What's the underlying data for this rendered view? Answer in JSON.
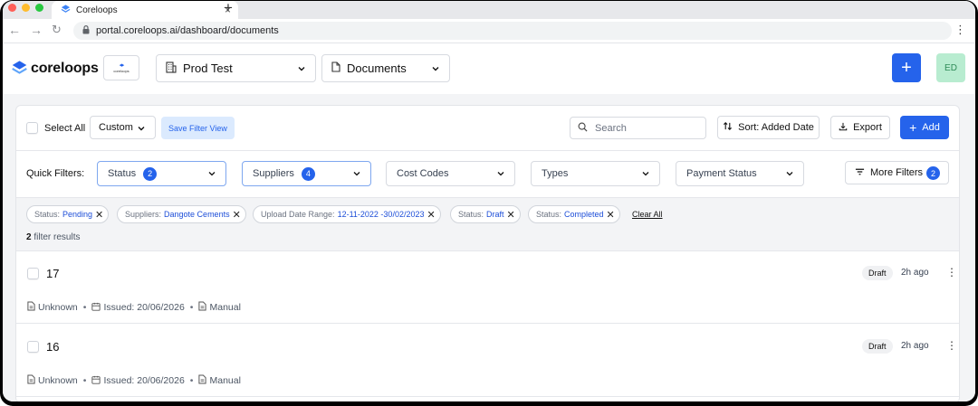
{
  "browser": {
    "tab_title": "Coreloops",
    "url": "portal.coreloops.ai/dashboard/documents",
    "tab_close": "×",
    "new_tab": "+",
    "menu_glyph": "⋮"
  },
  "header": {
    "logo_text": "coreloops",
    "org_thumb_text": "coreloops",
    "org_dropdown": "Prod Test",
    "section_dropdown": "Documents",
    "plus_glyph": "+",
    "avatar_initials": "ED"
  },
  "toolbar": {
    "select_all": "Select All",
    "view_dropdown": "Custom",
    "save_filter_view": "Save Filter View",
    "search_placeholder": "Search",
    "sort_label": "Sort: Added Date",
    "export_label": "Export",
    "add_label": "Add"
  },
  "quick_filters": {
    "label": "Quick Filters:",
    "items": [
      {
        "label": "Status",
        "count": "2"
      },
      {
        "label": "Suppliers",
        "count": "4"
      },
      {
        "label": "Cost Codes"
      },
      {
        "label": "Types"
      },
      {
        "label": "Payment Status"
      }
    ],
    "more_filters": {
      "label": "More Filters",
      "count": "2"
    }
  },
  "applied_filters": {
    "chips": [
      {
        "key": "Status:",
        "value": "Pending"
      },
      {
        "key": "Suppliers:",
        "value": "Dangote Cements"
      },
      {
        "key": "Upload Date Range:",
        "value": "12-11-2022 -30/02/2023"
      },
      {
        "key": "Status:",
        "value": "Draft"
      },
      {
        "key": "Status:",
        "value": "Completed"
      }
    ],
    "clear_all": "Clear All",
    "result_count": "2",
    "result_text": "filter results"
  },
  "documents": [
    {
      "id": "17",
      "status": "Draft",
      "age": "2h ago",
      "supplier": "Unknown",
      "issued": "Issued: 20/06/2026",
      "source": "Manual"
    },
    {
      "id": "16",
      "status": "Draft",
      "age": "2h ago",
      "supplier": "Unknown",
      "issued": "Issued: 20/06/2026",
      "source": "Manual"
    }
  ],
  "colors": {
    "accent": "#2563eb",
    "accent_light": "#dbeafe",
    "avatar_bg": "#b8ecd0",
    "page_bg": "#f3f4f6"
  },
  "icons": [
    "layers-icon",
    "building-icon",
    "document-icon",
    "search-icon",
    "sort-icon",
    "export-icon",
    "filter-icon",
    "calendar-icon",
    "chevron-down-icon",
    "close-icon",
    "more-vertical-icon",
    "lock-icon"
  ]
}
